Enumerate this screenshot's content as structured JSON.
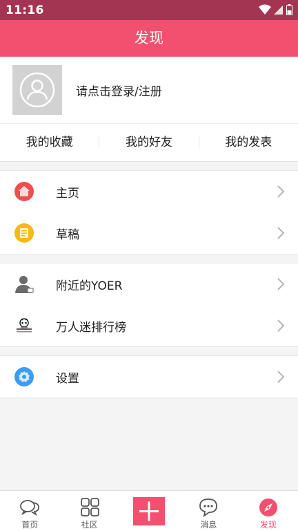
{
  "status_bar": {
    "time": "11:16"
  },
  "header": {
    "title": "发现"
  },
  "profile": {
    "login_prompt": "请点击登录/注册"
  },
  "quick_links": [
    {
      "label": "我的收藏"
    },
    {
      "label": "我的好友"
    },
    {
      "label": "我的发表"
    }
  ],
  "menu_groups": [
    {
      "items": [
        {
          "label": "主页",
          "icon": "home-icon",
          "color": "#ef4e4e"
        },
        {
          "label": "草稿",
          "icon": "drafts-icon",
          "color": "#f6b81a"
        }
      ]
    },
    {
      "items": [
        {
          "label": "附近的YOER",
          "icon": "nearby-person-icon",
          "color": "#666666"
        },
        {
          "label": "万人迷排行榜",
          "icon": "ranking-icon",
          "color": "#333333"
        }
      ]
    },
    {
      "items": [
        {
          "label": "设置",
          "icon": "settings-icon",
          "color": "#3d9cf2"
        }
      ]
    }
  ],
  "bottom_nav": [
    {
      "label": "首页",
      "icon": "chat-bubbles-icon"
    },
    {
      "label": "社区",
      "icon": "grid-icon"
    },
    {
      "label": "",
      "icon": "plus-icon"
    },
    {
      "label": "消息",
      "icon": "message-icon"
    },
    {
      "label": "发现",
      "icon": "compass-icon",
      "active": true
    }
  ],
  "colors": {
    "brand": "#f2506e",
    "status_bar": "#a33552"
  }
}
